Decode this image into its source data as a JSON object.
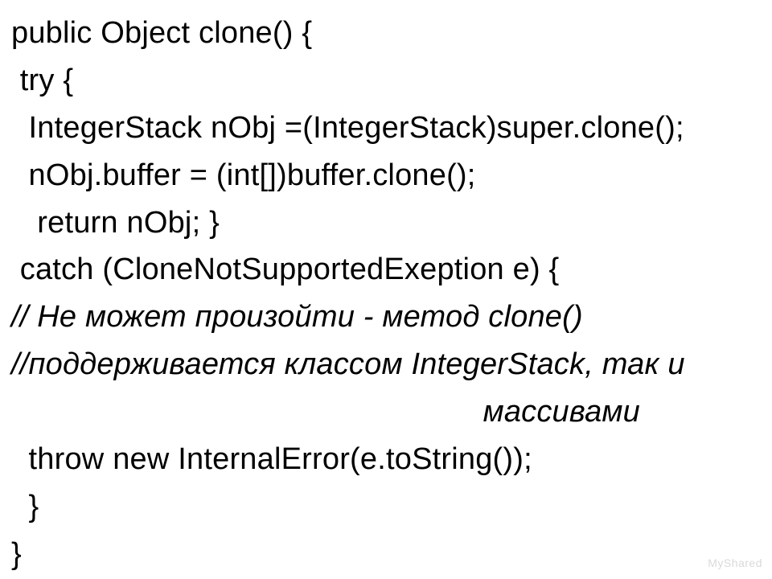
{
  "code": {
    "l1": "public Object clone() {",
    "l2": " try {",
    "l3": "  IntegerStack nObj =(IntegerStack)super.clone();",
    "l4": "  nObj.buffer = (int[])buffer.clone();",
    "l5": "   return nObj; }",
    "l6": " catch (CloneNotSupportedExeption e) {",
    "l7": "// Не может произойти - метод clone()",
    "l8": "//поддерживается классом IntegerStack, так и",
    "l9": "массивами",
    "l10": "  throw new InternalError(e.toString());",
    "l11": "  }",
    "l12": "}"
  },
  "watermark": "MyShared"
}
